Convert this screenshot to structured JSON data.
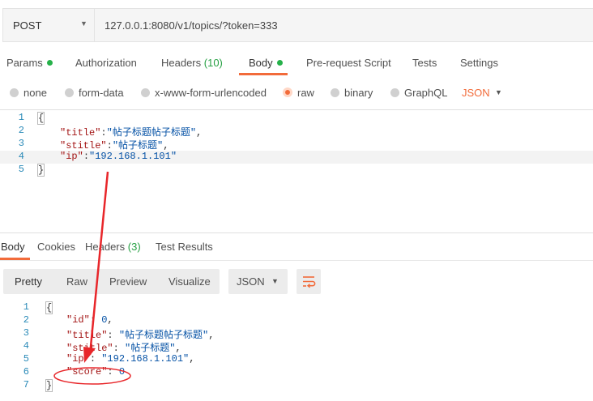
{
  "request": {
    "method": "POST",
    "url": "127.0.0.1:8080/v1/topics/?token=333"
  },
  "request_tabs": {
    "params": "Params",
    "authorization": "Authorization",
    "headers": "Headers",
    "headers_count": "(10)",
    "body": "Body",
    "prerequest": "Pre-request Script",
    "tests": "Tests",
    "settings": "Settings"
  },
  "body_types": {
    "none": "none",
    "form_data": "form-data",
    "urlencoded": "x-www-form-urlencoded",
    "raw": "raw",
    "binary": "binary",
    "graphql": "GraphQL",
    "format": "JSON",
    "selected": "raw"
  },
  "request_body": {
    "line_numbers": [
      "1",
      "2",
      "3",
      "4",
      "5"
    ],
    "open": "{",
    "close": "}",
    "fields": [
      {
        "key": "\"title\"",
        "value": "\"帖子标题帖子标题\"",
        "sep": ","
      },
      {
        "key": "\"stitle\"",
        "value": "\"帖子标题\"",
        "sep": ","
      },
      {
        "key": "\"ip\"",
        "value": "\"192.168.1.101\"",
        "sep": ""
      }
    ]
  },
  "response_tabs": {
    "body": "Body",
    "cookies": "Cookies",
    "headers": "Headers",
    "headers_count": "(3)",
    "test_results": "Test Results"
  },
  "view_modes": {
    "pretty": "Pretty",
    "raw": "Raw",
    "preview": "Preview",
    "visualize": "Visualize",
    "format": "JSON"
  },
  "response_body": {
    "line_numbers": [
      "1",
      "2",
      "3",
      "4",
      "5",
      "6",
      "7"
    ],
    "open": "{",
    "close": "}",
    "fields": [
      {
        "key": "\"id\"",
        "value": "0",
        "sep": ","
      },
      {
        "key": "\"title\"",
        "value": "\"帖子标题帖子标题\"",
        "sep": ","
      },
      {
        "key": "\"stitle\"",
        "value": "\"帖子标题\"",
        "sep": ","
      },
      {
        "key": "\"ip\"",
        "value": "\"192.168.1.101\"",
        "sep": ","
      },
      {
        "key": "\"score\"",
        "value": "0",
        "sep": ""
      }
    ]
  },
  "colors": {
    "accent": "#f26b3a",
    "annotation": "#e8262a",
    "active_dot": "#26b14a"
  }
}
